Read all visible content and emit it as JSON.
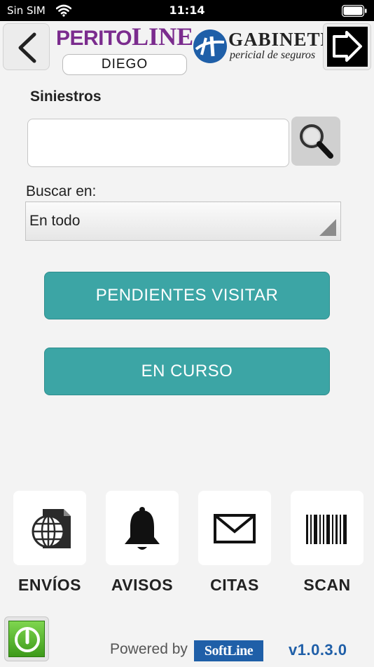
{
  "status_bar": {
    "carrier": "Sin SIM",
    "time": "11:14"
  },
  "header": {
    "back_icon": "chevron-left-icon",
    "logo_left": {
      "part1": "PERITO",
      "part2": "LINE"
    },
    "user_name": "DIEGO",
    "logo_right": {
      "title": "GABINETE",
      "subtitle": "pericial de seguros"
    },
    "logout_icon": "logout-arrow-icon"
  },
  "search": {
    "section_title": "Siniestros",
    "input_value": "",
    "input_placeholder": "",
    "search_icon": "magnifier-icon",
    "search_in_label": "Buscar en:",
    "search_in_selected": "En todo"
  },
  "actions": {
    "pending_label": "PENDIENTES VISITAR",
    "in_progress_label": "EN CURSO",
    "accent_color": "#3ca5a5"
  },
  "tiles": [
    {
      "label": "ENVÍOS",
      "icon": "globe-document-icon"
    },
    {
      "label": "AVISOS",
      "icon": "bell-icon"
    },
    {
      "label": "CITAS",
      "icon": "envelope-icon"
    },
    {
      "label": "SCAN",
      "icon": "barcode-icon"
    }
  ],
  "footer": {
    "power_icon": "power-icon",
    "powered_by": "Powered by",
    "brand": "SoftLine",
    "version": "v1.0.3.0"
  }
}
